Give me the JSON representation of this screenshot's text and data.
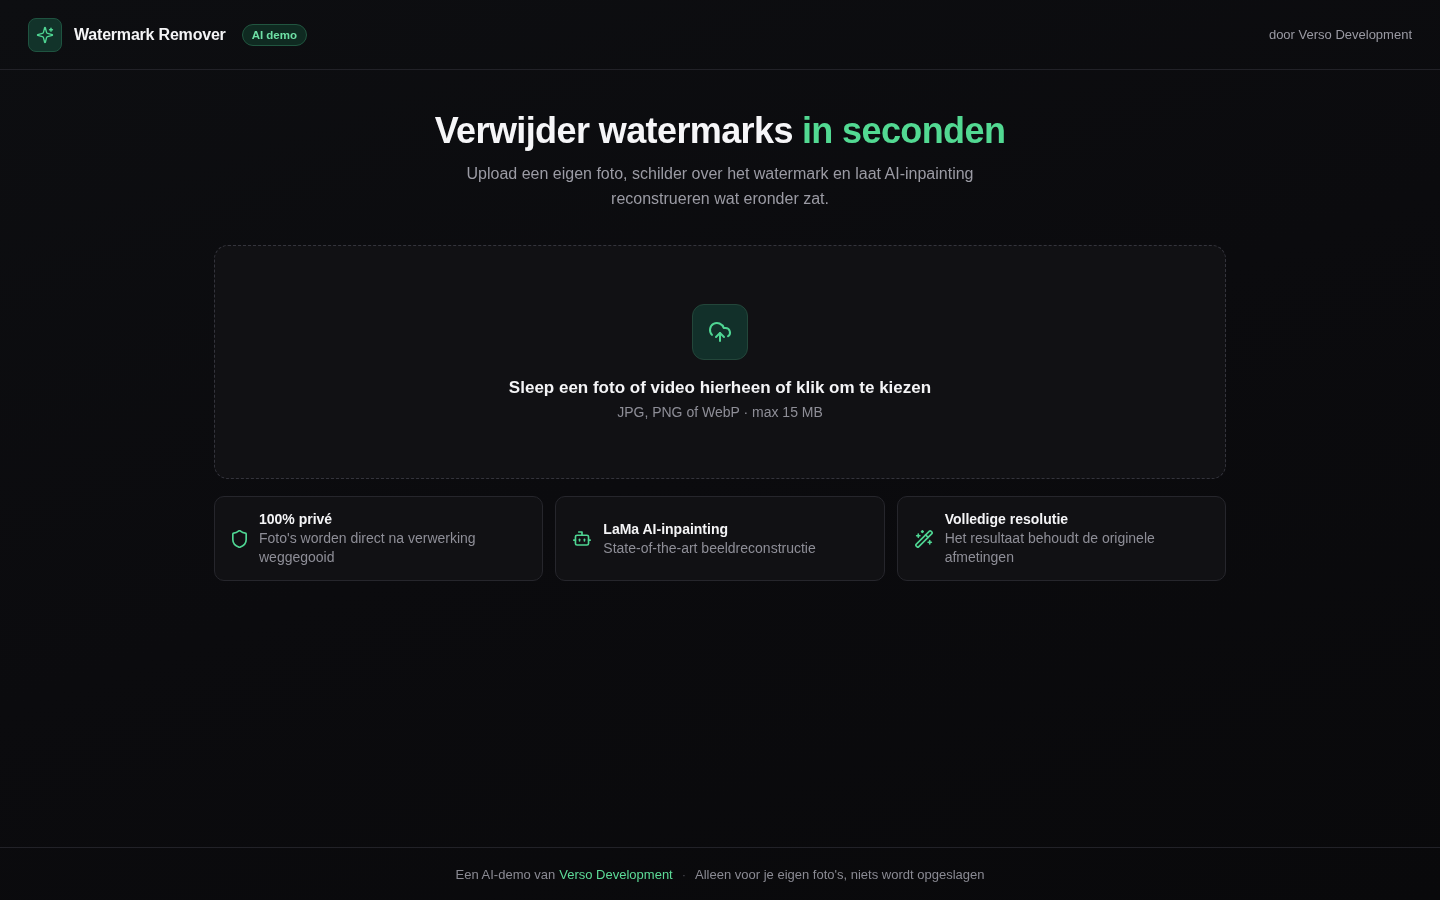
{
  "header": {
    "logo_title": "Watermark Remover",
    "badge": "AI demo",
    "byline": "door Verso Development"
  },
  "hero": {
    "title": "Verwijder watermarks",
    "title_highlight": "in seconden",
    "subtitle": "Upload een eigen foto, schilder over het watermark en laat AI-inpainting reconstrueren wat eronder zat."
  },
  "dropzone": {
    "title": "Sleep een foto of video hierheen of klik om te kiezen",
    "hint": "JPG, PNG of WebP · max 15 MB"
  },
  "features": [
    {
      "kind": "shield",
      "title": "100% privé",
      "description": "Foto's worden direct na verwerking weggegooid"
    },
    {
      "kind": "robot",
      "title": "LaMa AI-inpainting",
      "description": "State-of-the-art beeldreconstructie"
    },
    {
      "kind": "wand",
      "title": "Volledige resolutie",
      "description": "Het resultaat behoudt de originele afmetingen"
    }
  ],
  "footer": {
    "credit_prefix": "Een AI-demo van",
    "credit_link": "Verso Development",
    "separator": "·",
    "notice": "Alleen voor je eigen foto's, niets wordt opgeslagen"
  }
}
